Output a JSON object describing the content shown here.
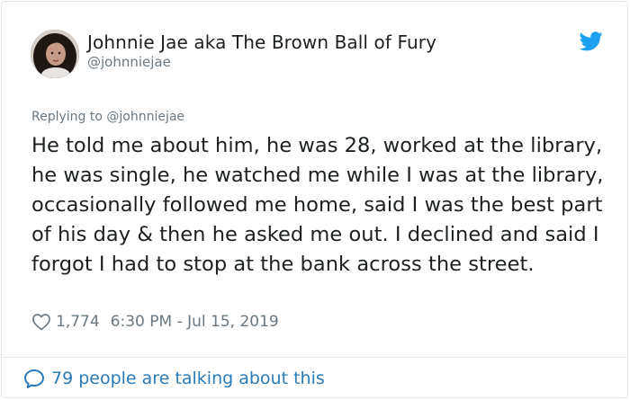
{
  "tweet": {
    "author": {
      "display_name": "Johnnie Jae aka The Brown Ball of Fury",
      "handle": "@johnniejae",
      "avatar": "profile-photo"
    },
    "replying_to": "Replying to @johnniejae",
    "text": "He told me about him, he was 28, worked at the library, he was single, he watched me while I was at the library, occasionally followed me home, said I was the best part of his day & then he asked me out. I declined and said I forgot I had to stop at the bank across the street.",
    "likes": "1,774",
    "timestamp": "6:30 PM - Jul 15, 2019",
    "conversation_link": "79 people are talking about this"
  },
  "icons": {
    "brand": "twitter-bird-icon",
    "like": "heart-icon",
    "conversation": "speech-bubble-icon"
  },
  "colors": {
    "twitter_blue": "#1da1f2",
    "link_blue": "#2b7bb9",
    "text_primary": "#1c2022",
    "text_secondary": "#697882",
    "border": "#e1e8ed"
  }
}
